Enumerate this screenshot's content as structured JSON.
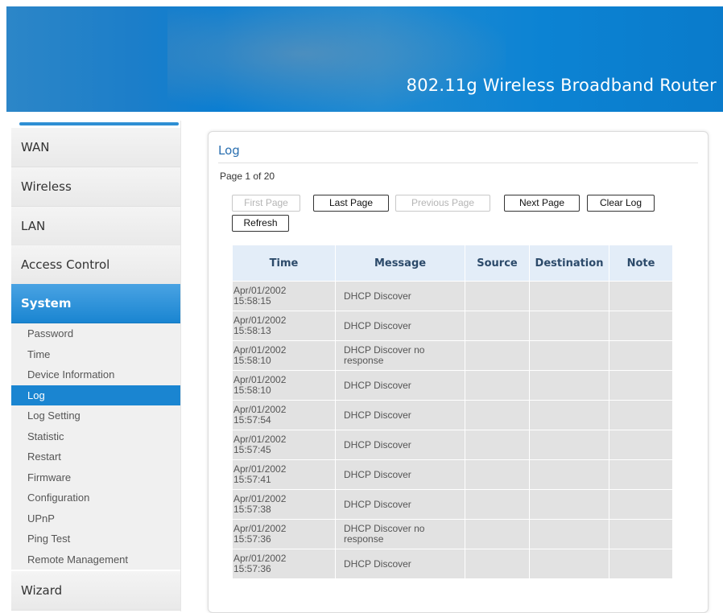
{
  "header": {
    "title": "802.11g Wireless Broadband Router"
  },
  "sidebar": {
    "main_items": [
      {
        "label": "WAN"
      },
      {
        "label": "Wireless"
      },
      {
        "label": "LAN"
      },
      {
        "label": "Access Control"
      },
      {
        "label": "System",
        "active": true
      },
      {
        "label": "Wizard"
      }
    ],
    "system_submenu": [
      {
        "label": "Password"
      },
      {
        "label": "Time"
      },
      {
        "label": "Device Information"
      },
      {
        "label": "Log",
        "active": true
      },
      {
        "label": "Log Setting"
      },
      {
        "label": "Statistic"
      },
      {
        "label": "Restart"
      },
      {
        "label": "Firmware"
      },
      {
        "label": "Configuration"
      },
      {
        "label": "UPnP"
      },
      {
        "label": "Ping Test"
      },
      {
        "label": "Remote Management"
      }
    ]
  },
  "main": {
    "title": "Log",
    "page_info": "Page 1 of 20",
    "buttons": {
      "first_page": "First Page",
      "last_page": "Last Page",
      "previous_page": "Previous Page",
      "next_page": "Next Page",
      "clear_log": "Clear Log",
      "refresh": "Refresh"
    },
    "table": {
      "headers": [
        "Time",
        "Message",
        "Source",
        "Destination",
        "Note"
      ],
      "rows": [
        {
          "date": "Apr/01/2002",
          "time": "15:58:15",
          "message": "DHCP Discover",
          "message_cont": "",
          "source": "",
          "destination": "",
          "note": ""
        },
        {
          "date": "Apr/01/2002",
          "time": "15:58:13",
          "message": "DHCP Discover",
          "message_cont": "",
          "source": "",
          "destination": "",
          "note": ""
        },
        {
          "date": "Apr/01/2002",
          "time": "15:58:10",
          "message": "DHCP Discover no",
          "message_cont": "response",
          "source": "",
          "destination": "",
          "note": ""
        },
        {
          "date": "Apr/01/2002",
          "time": "15:58:10",
          "message": "DHCP Discover",
          "message_cont": "",
          "source": "",
          "destination": "",
          "note": ""
        },
        {
          "date": "Apr/01/2002",
          "time": "15:57:54",
          "message": "DHCP Discover",
          "message_cont": "",
          "source": "",
          "destination": "",
          "note": ""
        },
        {
          "date": "Apr/01/2002",
          "time": "15:57:45",
          "message": "DHCP Discover",
          "message_cont": "",
          "source": "",
          "destination": "",
          "note": ""
        },
        {
          "date": "Apr/01/2002",
          "time": "15:57:41",
          "message": "DHCP Discover",
          "message_cont": "",
          "source": "",
          "destination": "",
          "note": ""
        },
        {
          "date": "Apr/01/2002",
          "time": "15:57:38",
          "message": "DHCP Discover",
          "message_cont": "",
          "source": "",
          "destination": "",
          "note": ""
        },
        {
          "date": "Apr/01/2002",
          "time": "15:57:36",
          "message": "DHCP Discover no",
          "message_cont": "response",
          "source": "",
          "destination": "",
          "note": ""
        },
        {
          "date": "Apr/01/2002",
          "time": "15:57:36",
          "message": "DHCP Discover",
          "message_cont": "",
          "source": "",
          "destination": "",
          "note": ""
        }
      ]
    }
  }
}
